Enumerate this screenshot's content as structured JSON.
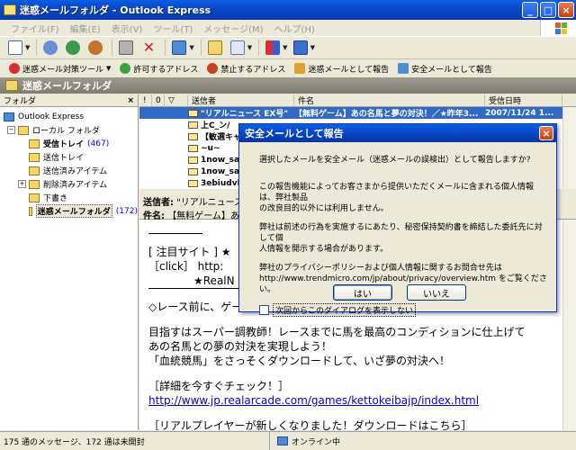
{
  "window": {
    "title": "迷惑メールフォルダ - Outlook Express"
  },
  "menu": [
    "ファイル(F)",
    "編集(E)",
    "表示(V)",
    "ツール(T)",
    "メッセージ(M)",
    "ヘルプ(H)"
  ],
  "toolbar_icons": [
    "create-mail-icon",
    "reply-icon",
    "reply-all-icon",
    "forward-icon",
    "print-icon",
    "delete-icon",
    "send-receive-icon",
    "addresses-icon",
    "find-icon",
    "encoding-icon",
    "view-icon"
  ],
  "trend_toolbar": [
    "迷惑メール対策ツール",
    "許可するアドレス",
    "禁止するアドレス",
    "迷惑メールとして報告",
    "安全メールとして報告"
  ],
  "folder_header": "迷惑メールフォルダ",
  "left_pane": {
    "header": "フォルダ",
    "tree": [
      {
        "label": "Outlook Express",
        "count": ""
      },
      {
        "label": "ローカル フォルダ",
        "count": ""
      },
      {
        "label": "受信トレイ",
        "count": "(467)"
      },
      {
        "label": "送信トレイ",
        "count": ""
      },
      {
        "label": "送信済みアイテム",
        "count": ""
      },
      {
        "label": "削除済みアイテム",
        "count": ""
      },
      {
        "label": "下書き",
        "count": ""
      },
      {
        "label": "迷惑メールフォルダ",
        "count": "(172)"
      }
    ]
  },
  "list": {
    "columns": [
      "!",
      "0",
      "▽",
      "送信者",
      "件名",
      "受信日時"
    ],
    "rows": [
      {
        "from": "\"リアルニュース EX号\"",
        "subject": "【無料ゲーム】あの名馬と夢の対決！／★昨年3...",
        "date": "2007/11/24 1..."
      },
      {
        "from": "上C_ン/",
        "subject": "",
        "date": ""
      },
      {
        "from": "【敏選キャ",
        "subject": "",
        "date": ""
      },
      {
        "from": "~u~",
        "subject": "",
        "date": ""
      },
      {
        "from": "1now_sale",
        "subject": "",
        "date": ""
      },
      {
        "from": "1now_sale",
        "subject": "",
        "date": ""
      },
      {
        "from": "3ebiudvbe",
        "subject": "",
        "date": ""
      }
    ]
  },
  "preview": {
    "from_label": "送信者:",
    "from_value": "\"リアルニュース EX",
    "subject_label": "件名:",
    "subject_value": "【無料ゲーム】あの名",
    "lines": [
      "[ 注目サイト ] ★",
      "［click］ http:",
      "★RealN",
      "◇レース前に、ゲームで勝遭をシミュレーション！",
      "目指すはスーパー調教師！レースまでに馬を最高のコンディションに仕上げて",
      "あの名馬との夢の対決を実現しよう！",
      "「血統競馬」をさっそくダウンロードして、いざ夢の対決へ！",
      "［詳細を今すぐチェック！］",
      "http://www.jp.realarcade.com/games/kettokeibajp/index.html",
      "［リアルプレイヤーが新しくなりました！ダウンロードはこちら］"
    ]
  },
  "status": {
    "left": "175 通のメッセージ、172 通は未開封",
    "mid": "オンライン中"
  },
  "dialog": {
    "title": "安全メールとして報告",
    "p1": "選択したメールを安全メール（迷惑メールの誤検出）として報告しますか?",
    "p2a": "この報告機能によってお客さまから提供いただくメールに含まれる個人情報は、弊社製品",
    "p2b": "の改良目的以外には利用しません。",
    "p3a": "弊社は前述の行為を実施するにあたり、秘密保持契約書を締結した委託先に対して個",
    "p3b": "人情報を開示する場合があります。",
    "p4a": "弊社のプライバシーポリシーおよび個人情報に関するお問合せ先は",
    "p4b": "http://www.trendmicro.com/jp/about/privacy/overview.htm をご覧ください。",
    "checkbox": "次回からこのダイアログを表示しない",
    "yes": "はい",
    "no": "いいえ"
  }
}
